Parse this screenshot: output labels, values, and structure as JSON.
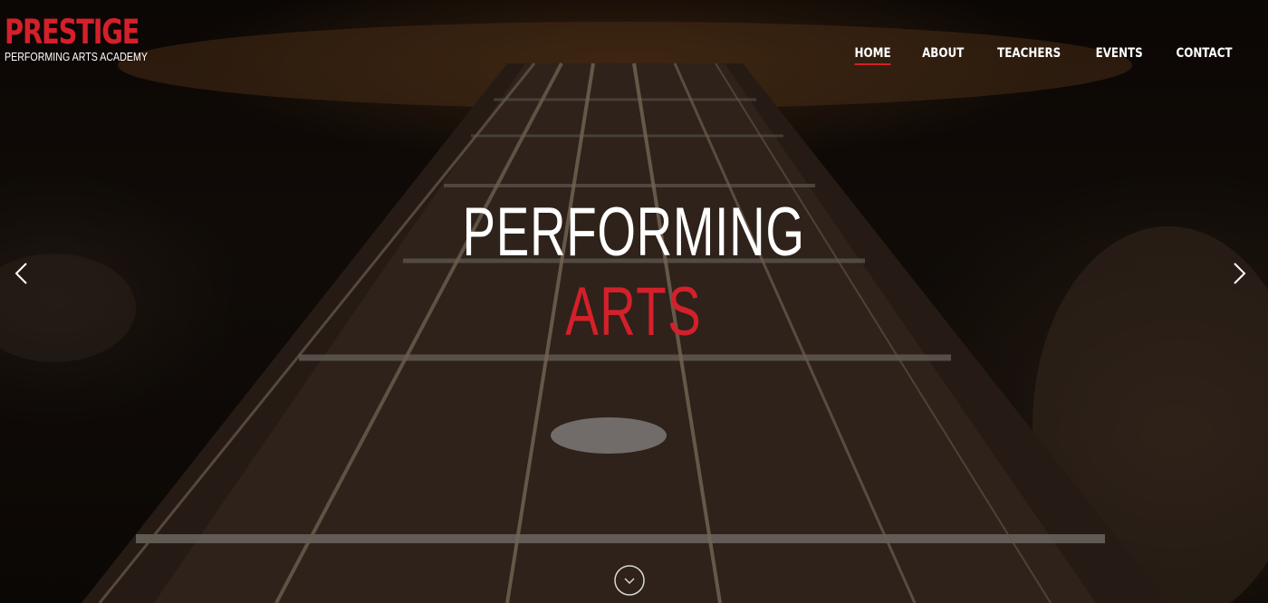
{
  "header": {
    "logo_title": "PRESTIGE",
    "logo_subtitle": "PERFORMING ARTS ACADEMY"
  },
  "nav": {
    "items": [
      {
        "label": "HOME",
        "active": true
      },
      {
        "label": "ABOUT",
        "active": false
      },
      {
        "label": "TEACHERS",
        "active": false
      },
      {
        "label": "EVENTS",
        "active": false
      },
      {
        "label": "CONTACT",
        "active": false
      }
    ]
  },
  "hero": {
    "headline_line1": "PERFORMING",
    "headline_line2": "ARTS",
    "background_image": "guitar-fretboard-closeup",
    "prev_icon": "chevron-left-icon",
    "next_icon": "chevron-right-icon",
    "scroll_icon": "chevron-down-circle-icon"
  },
  "colors": {
    "accent": "#d4202a",
    "text": "#ffffff",
    "background": "#0b0705"
  }
}
